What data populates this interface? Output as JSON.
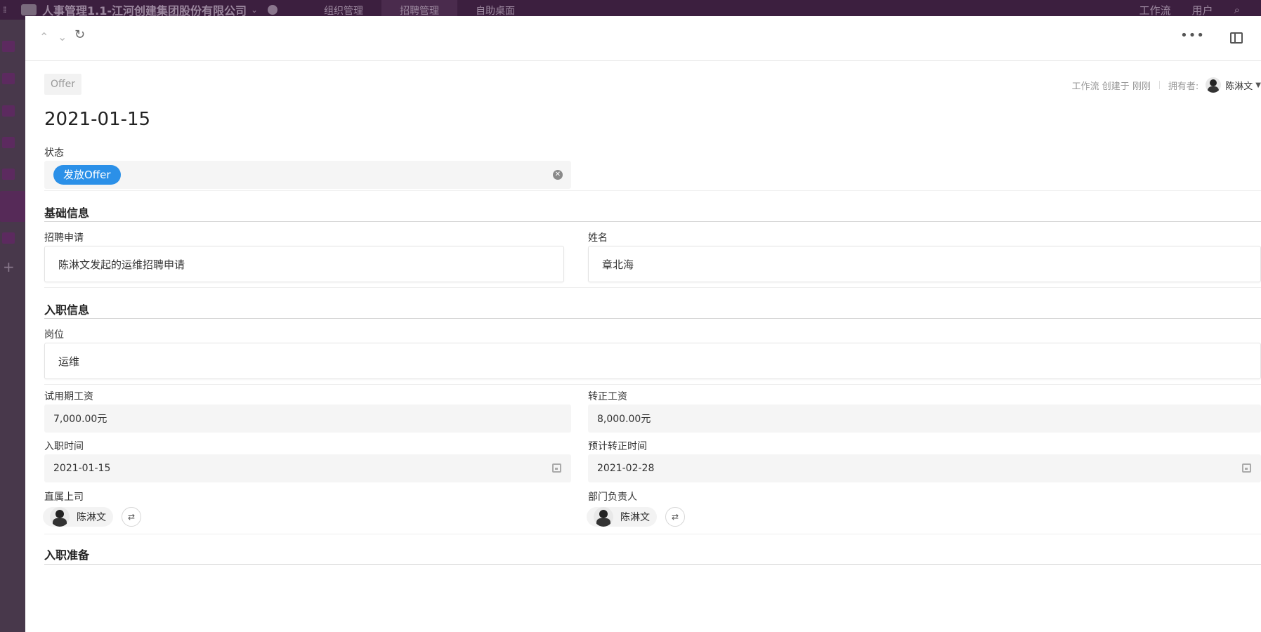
{
  "topbar": {
    "app_title": "人事管理1.1-江河创建集团股份有限公司",
    "nav": [
      "组织管理",
      "招聘管理",
      "自助桌面"
    ],
    "right": [
      "工作流",
      "用户"
    ]
  },
  "drawer": {
    "type_tag": "Offer",
    "meta_created": "工作流 创建于 刚刚",
    "owner_label": "拥有者:",
    "owner_name": "陈淋文",
    "title": "2021-01-15",
    "status": {
      "label": "状态",
      "value": "发放Offer",
      "color": "#2b90e8"
    },
    "sections": {
      "basic": "基础信息",
      "onboard": "入职信息",
      "prepare": "入职准备"
    },
    "fields": {
      "application": {
        "label": "招聘申请",
        "value": "陈淋文发起的运维招聘申请"
      },
      "name": {
        "label": "姓名",
        "value": "章北海"
      },
      "position": {
        "label": "岗位",
        "value": "运维"
      },
      "probation_salary": {
        "label": "试用期工资",
        "value": "7,000.00元"
      },
      "regular_salary": {
        "label": "转正工资",
        "value": "8,000.00元"
      },
      "onboard_date": {
        "label": "入职时间",
        "value": "2021-01-15"
      },
      "regular_date": {
        "label": "预计转正时间",
        "value": "2021-02-28"
      },
      "supervisor": {
        "label": "直属上司",
        "value": "陈淋文"
      },
      "dept_head": {
        "label": "部门负责人",
        "value": "陈淋文"
      }
    }
  }
}
